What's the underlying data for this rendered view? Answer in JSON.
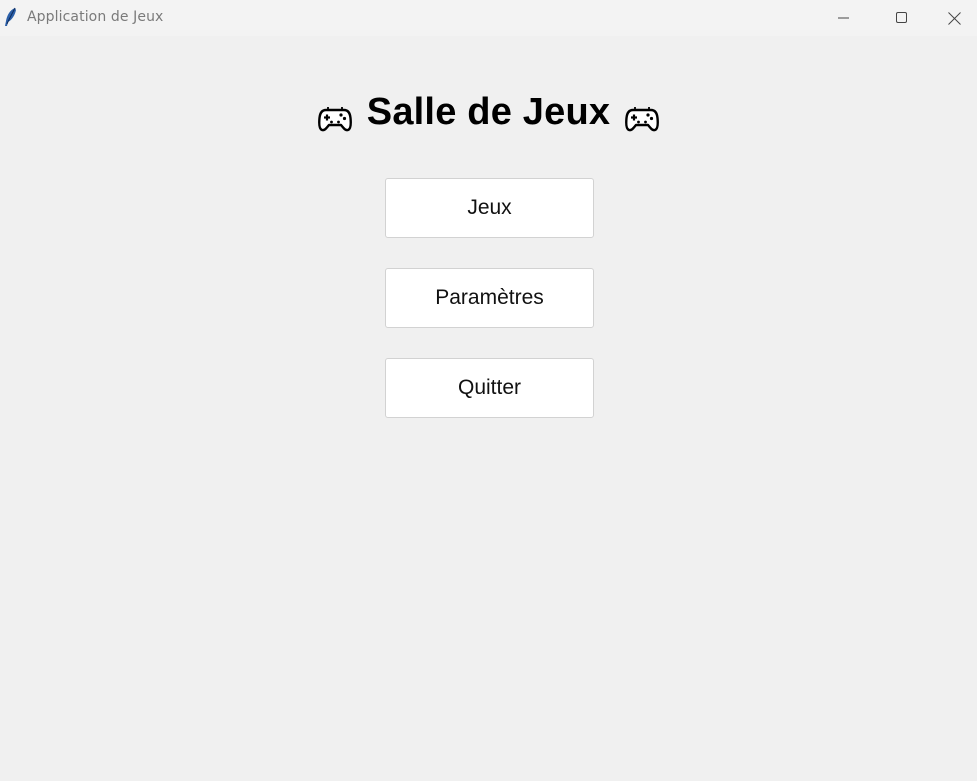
{
  "window": {
    "title": "Application de Jeux",
    "icon": "feather-icon",
    "controls": [
      "minimize-icon",
      "maximize-icon",
      "close-icon"
    ]
  },
  "header": {
    "title": "Salle de Jeux",
    "left_icon": "gamepad-icon",
    "right_icon": "gamepad-icon"
  },
  "menu": {
    "games_label": "Jeux",
    "settings_label": "Paramètres",
    "quit_label": "Quitter"
  },
  "colors": {
    "background": "#f0f0f0",
    "button_bg": "#ffffff",
    "button_border": "#d2d2d2",
    "title_text": "#000000"
  }
}
